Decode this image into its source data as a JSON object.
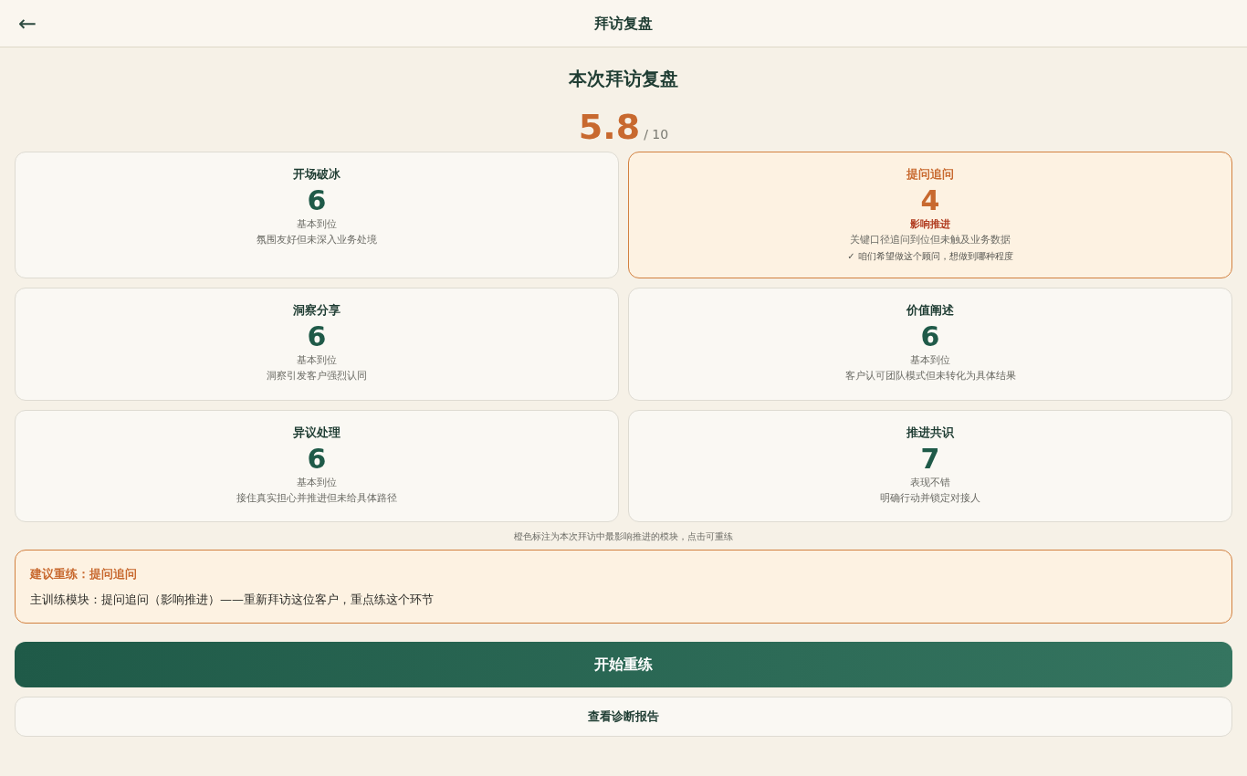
{
  "header": {
    "back": "←",
    "title": "拜访复盘"
  },
  "heading": "本次拜访复盘",
  "score": {
    "value": "5.8",
    "max": "/ 10"
  },
  "modules": [
    {
      "name": "开场破冰",
      "score": "6",
      "weak": false,
      "grade": "基本到位",
      "comment": "氛围友好但未深入业务处境"
    },
    {
      "name": "提问追问",
      "score": "4",
      "weak": true,
      "grade": "影响推进",
      "comment": "关键口径追问到位但未触及业务数据",
      "note": "✓ 咱们希望做这个顾问，想做到哪种程度"
    },
    {
      "name": "洞察分享",
      "score": "6",
      "weak": false,
      "grade": "基本到位",
      "comment": "洞察引发客户强烈认同"
    },
    {
      "name": "价值阐述",
      "score": "6",
      "weak": false,
      "grade": "基本到位",
      "comment": "客户认可团队模式但未转化为具体结果"
    },
    {
      "name": "异议处理",
      "score": "6",
      "weak": false,
      "grade": "基本到位",
      "comment": "接住真实担心并推进但未给具体路径"
    },
    {
      "name": "推进共识",
      "score": "7",
      "weak": false,
      "grade": "表现不错",
      "comment": "明确行动并锁定对接人"
    }
  ],
  "legend": "橙色标注为本次拜访中最影响推进的模块，点击可重练",
  "suggestion": {
    "title": "建议重练：提问追问",
    "body": "主训练模块：提问追问（影响推进）——重新拜访这位客户，重点练这个环节"
  },
  "primary_button": "开始重练",
  "secondary_button": "查看诊断报告"
}
